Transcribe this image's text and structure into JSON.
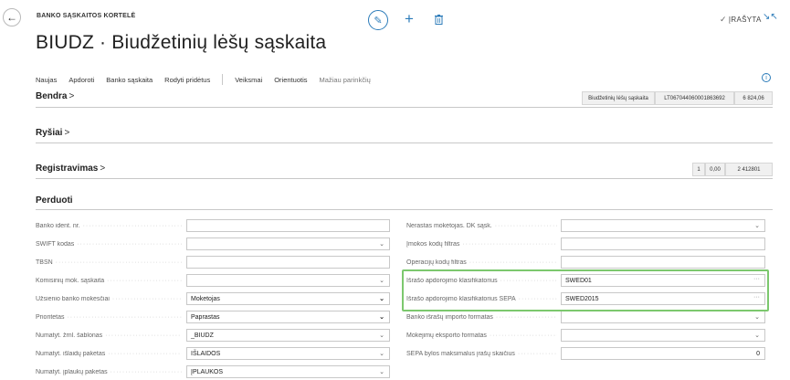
{
  "header": {
    "card_label": "BANKO SĄSKAITOS KORTELĖ",
    "title": "BIUDZ · Biudžetinių lėšų sąskaita",
    "saved_status": "ĮRAŠYTA"
  },
  "actions": {
    "items": [
      "Naujas",
      "Apdoroti",
      "Banko sąskaita",
      "Rodyti pridėtus"
    ],
    "items2": [
      "Veiksmai",
      "Orientuotis"
    ],
    "fewer_options": "Mažiau parinkčių"
  },
  "sections": {
    "bendra": {
      "title": "Bendra",
      "cues": [
        "Biudžetinių lėšų sąskaita",
        "LT067044060001863692",
        "6 824,06"
      ]
    },
    "rysiai": {
      "title": "Ryšiai"
    },
    "registravimas": {
      "title": "Registravimas",
      "cues": [
        "1",
        "0,00",
        "2 412801"
      ]
    },
    "perduoti": {
      "title": "Perduoti"
    }
  },
  "fields_left": [
    {
      "label": "Banko ident. nr.",
      "value": "",
      "type": "text"
    },
    {
      "label": "SWIFT kodas",
      "value": "",
      "type": "select"
    },
    {
      "label": "TBSN",
      "value": "",
      "type": "text"
    },
    {
      "label": "Komisinių mok. sąskaita",
      "value": "",
      "type": "select"
    },
    {
      "label": "Užsienio banko mokesčiai",
      "value": "Moketojas",
      "type": "select-bold"
    },
    {
      "label": "Prioritetas",
      "value": "Paprastas",
      "type": "select-bold"
    },
    {
      "label": "Numatyt. žrnl. šablonas",
      "value": "_BIUDZ",
      "type": "select"
    },
    {
      "label": "Numatyt. išlaidų paketas",
      "value": "IŠLAIDOS",
      "type": "select"
    },
    {
      "label": "Numatyt. įplaukų paketas",
      "value": "ĮPLAUKOS",
      "type": "select"
    }
  ],
  "fields_right": [
    {
      "label": "Nerastas mokėtojas. DK sąsk.",
      "value": "",
      "type": "select"
    },
    {
      "label": "Įmokos kodų filtras",
      "value": "",
      "type": "text"
    },
    {
      "label": "Operacijų kodų filtras",
      "value": "",
      "type": "text"
    },
    {
      "label": "Išrašo apdorojimo klasifikatorius",
      "value": "SWED01",
      "type": "lookup"
    },
    {
      "label": "Išrašo apdorojimo klasifikatorius SEPA",
      "value": "SWED2015",
      "type": "lookup"
    },
    {
      "label": "Banko išrašų importo formatas",
      "value": "",
      "type": "select"
    },
    {
      "label": "Mokėjimų eksporto formatas",
      "value": "",
      "type": "select"
    },
    {
      "label": "SEPA bylos maksimalus įrašų skaičius",
      "value": "0",
      "type": "number"
    }
  ]
}
